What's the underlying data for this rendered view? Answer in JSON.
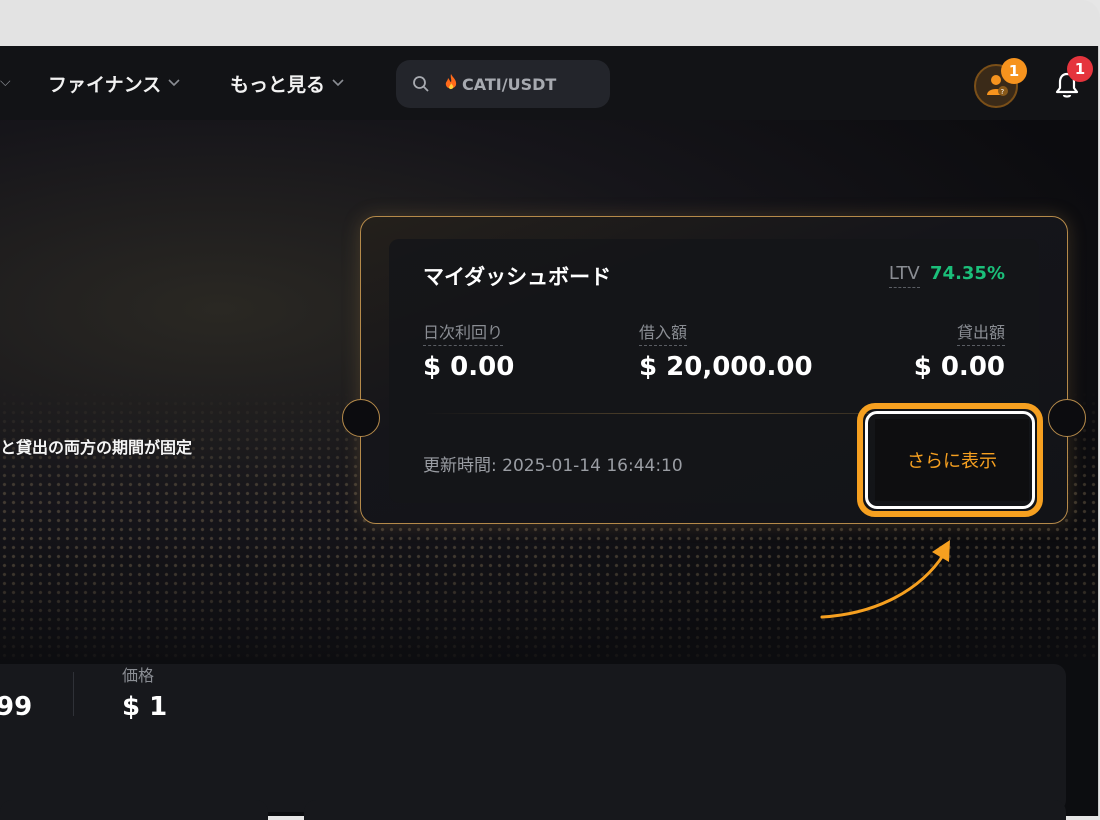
{
  "nav": {
    "items": [
      {
        "label": "ファイナンス"
      },
      {
        "label": "もっと見る"
      }
    ],
    "search": {
      "value": "CATI/USDT"
    },
    "badges": {
      "avatar_count": "1",
      "bell_count": "1"
    }
  },
  "hero": {
    "text": "と貸出の両方の期間が固定"
  },
  "dashboard": {
    "title": "マイダッシュボード",
    "ltv_label": "LTV",
    "ltv_value": "74.35%",
    "metrics": [
      {
        "label": "日次利回り",
        "value": "$ 0.00"
      },
      {
        "label": "借入額",
        "value": "$ 20,000.00"
      },
      {
        "label": "貸出額",
        "value": "$ 0.00"
      }
    ],
    "updated": "更新時間: 2025-01-14 16:44:10",
    "more_button": "さらに表示"
  },
  "stats": {
    "left_value_fragment": "99",
    "price_label": "価格",
    "price_value": "$ 1"
  },
  "colors": {
    "accent_orange": "#f6a020",
    "ltv_green": "#1bbf7a",
    "badge_red": "#e5343d",
    "card_border_gold": "#b58a4a"
  },
  "icons": [
    "search-icon",
    "fire-icon",
    "chevron-down-icon",
    "avatar-icon",
    "bell-icon",
    "arrow-icon"
  ]
}
